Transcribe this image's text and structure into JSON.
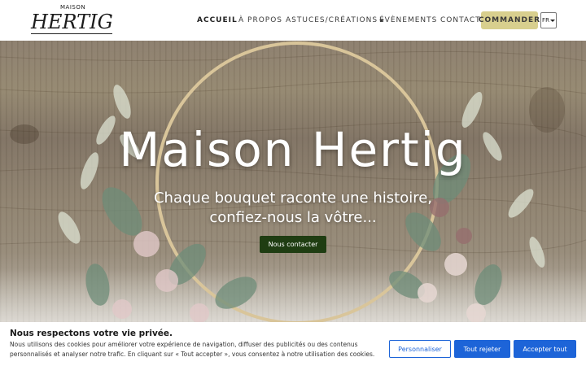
{
  "brand": {
    "small": "MAISON",
    "name": "HERTIG"
  },
  "nav": {
    "items": [
      {
        "label": "ACCUEIL"
      },
      {
        "label": "À PROPOS"
      },
      {
        "label": "ASTUCES/CRÉATIONS"
      },
      {
        "label": "ÉVÈNEMENTS"
      },
      {
        "label": "CONTACT"
      }
    ],
    "order_label": "COMMANDER",
    "lang": "FR"
  },
  "hero": {
    "title": "Maison Hertig",
    "subtitle_line1": "Chaque bouquet raconte une histoire,",
    "subtitle_line2": "confiez-nous la vôtre...",
    "cta": "Nous contacter"
  },
  "cookie": {
    "title": "Nous respectons votre vie privée.",
    "text": "Nous utilisons des cookies pour améliorer votre expérience de navigation, diffuser des publicités ou des contenus personnalisés et analyser notre trafic. En cliquant sur « Tout accepter », vous consentez à notre utilisation des cookies.",
    "customize": "Personnaliser",
    "reject": "Tout rejeter",
    "accept": "Accepter tout"
  },
  "colors": {
    "order_bg": "#d8cf8e",
    "cta_bg": "#1f3d12",
    "cookie_blue": "#1d64d8"
  }
}
